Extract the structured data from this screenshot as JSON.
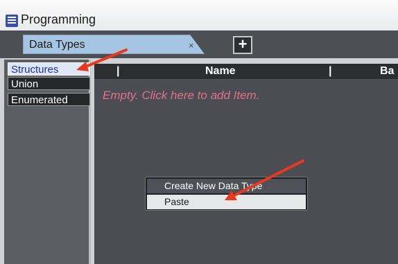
{
  "window": {
    "title": "Programming",
    "icon": "list-icon"
  },
  "tabs": [
    {
      "label": "Data Types",
      "close": "×"
    }
  ],
  "add_tab": {
    "label": "+"
  },
  "sidebar": {
    "items": [
      {
        "label": "Structures",
        "selected": true
      },
      {
        "label": "Union",
        "selected": false
      },
      {
        "label": "Enumerated",
        "selected": false
      }
    ]
  },
  "grid": {
    "columns": [
      "|",
      "Name",
      "|",
      "Ba"
    ],
    "empty_message": "Empty. Click here to add Item."
  },
  "context_menu": {
    "items": [
      {
        "label": "Create New Data Type",
        "highlighted": true
      },
      {
        "label": "Paste",
        "highlighted": false
      }
    ]
  },
  "colors": {
    "annotation_arrow": "#e8381f",
    "empty_text": "#e0708e",
    "selected_item": "#1f2f99"
  }
}
